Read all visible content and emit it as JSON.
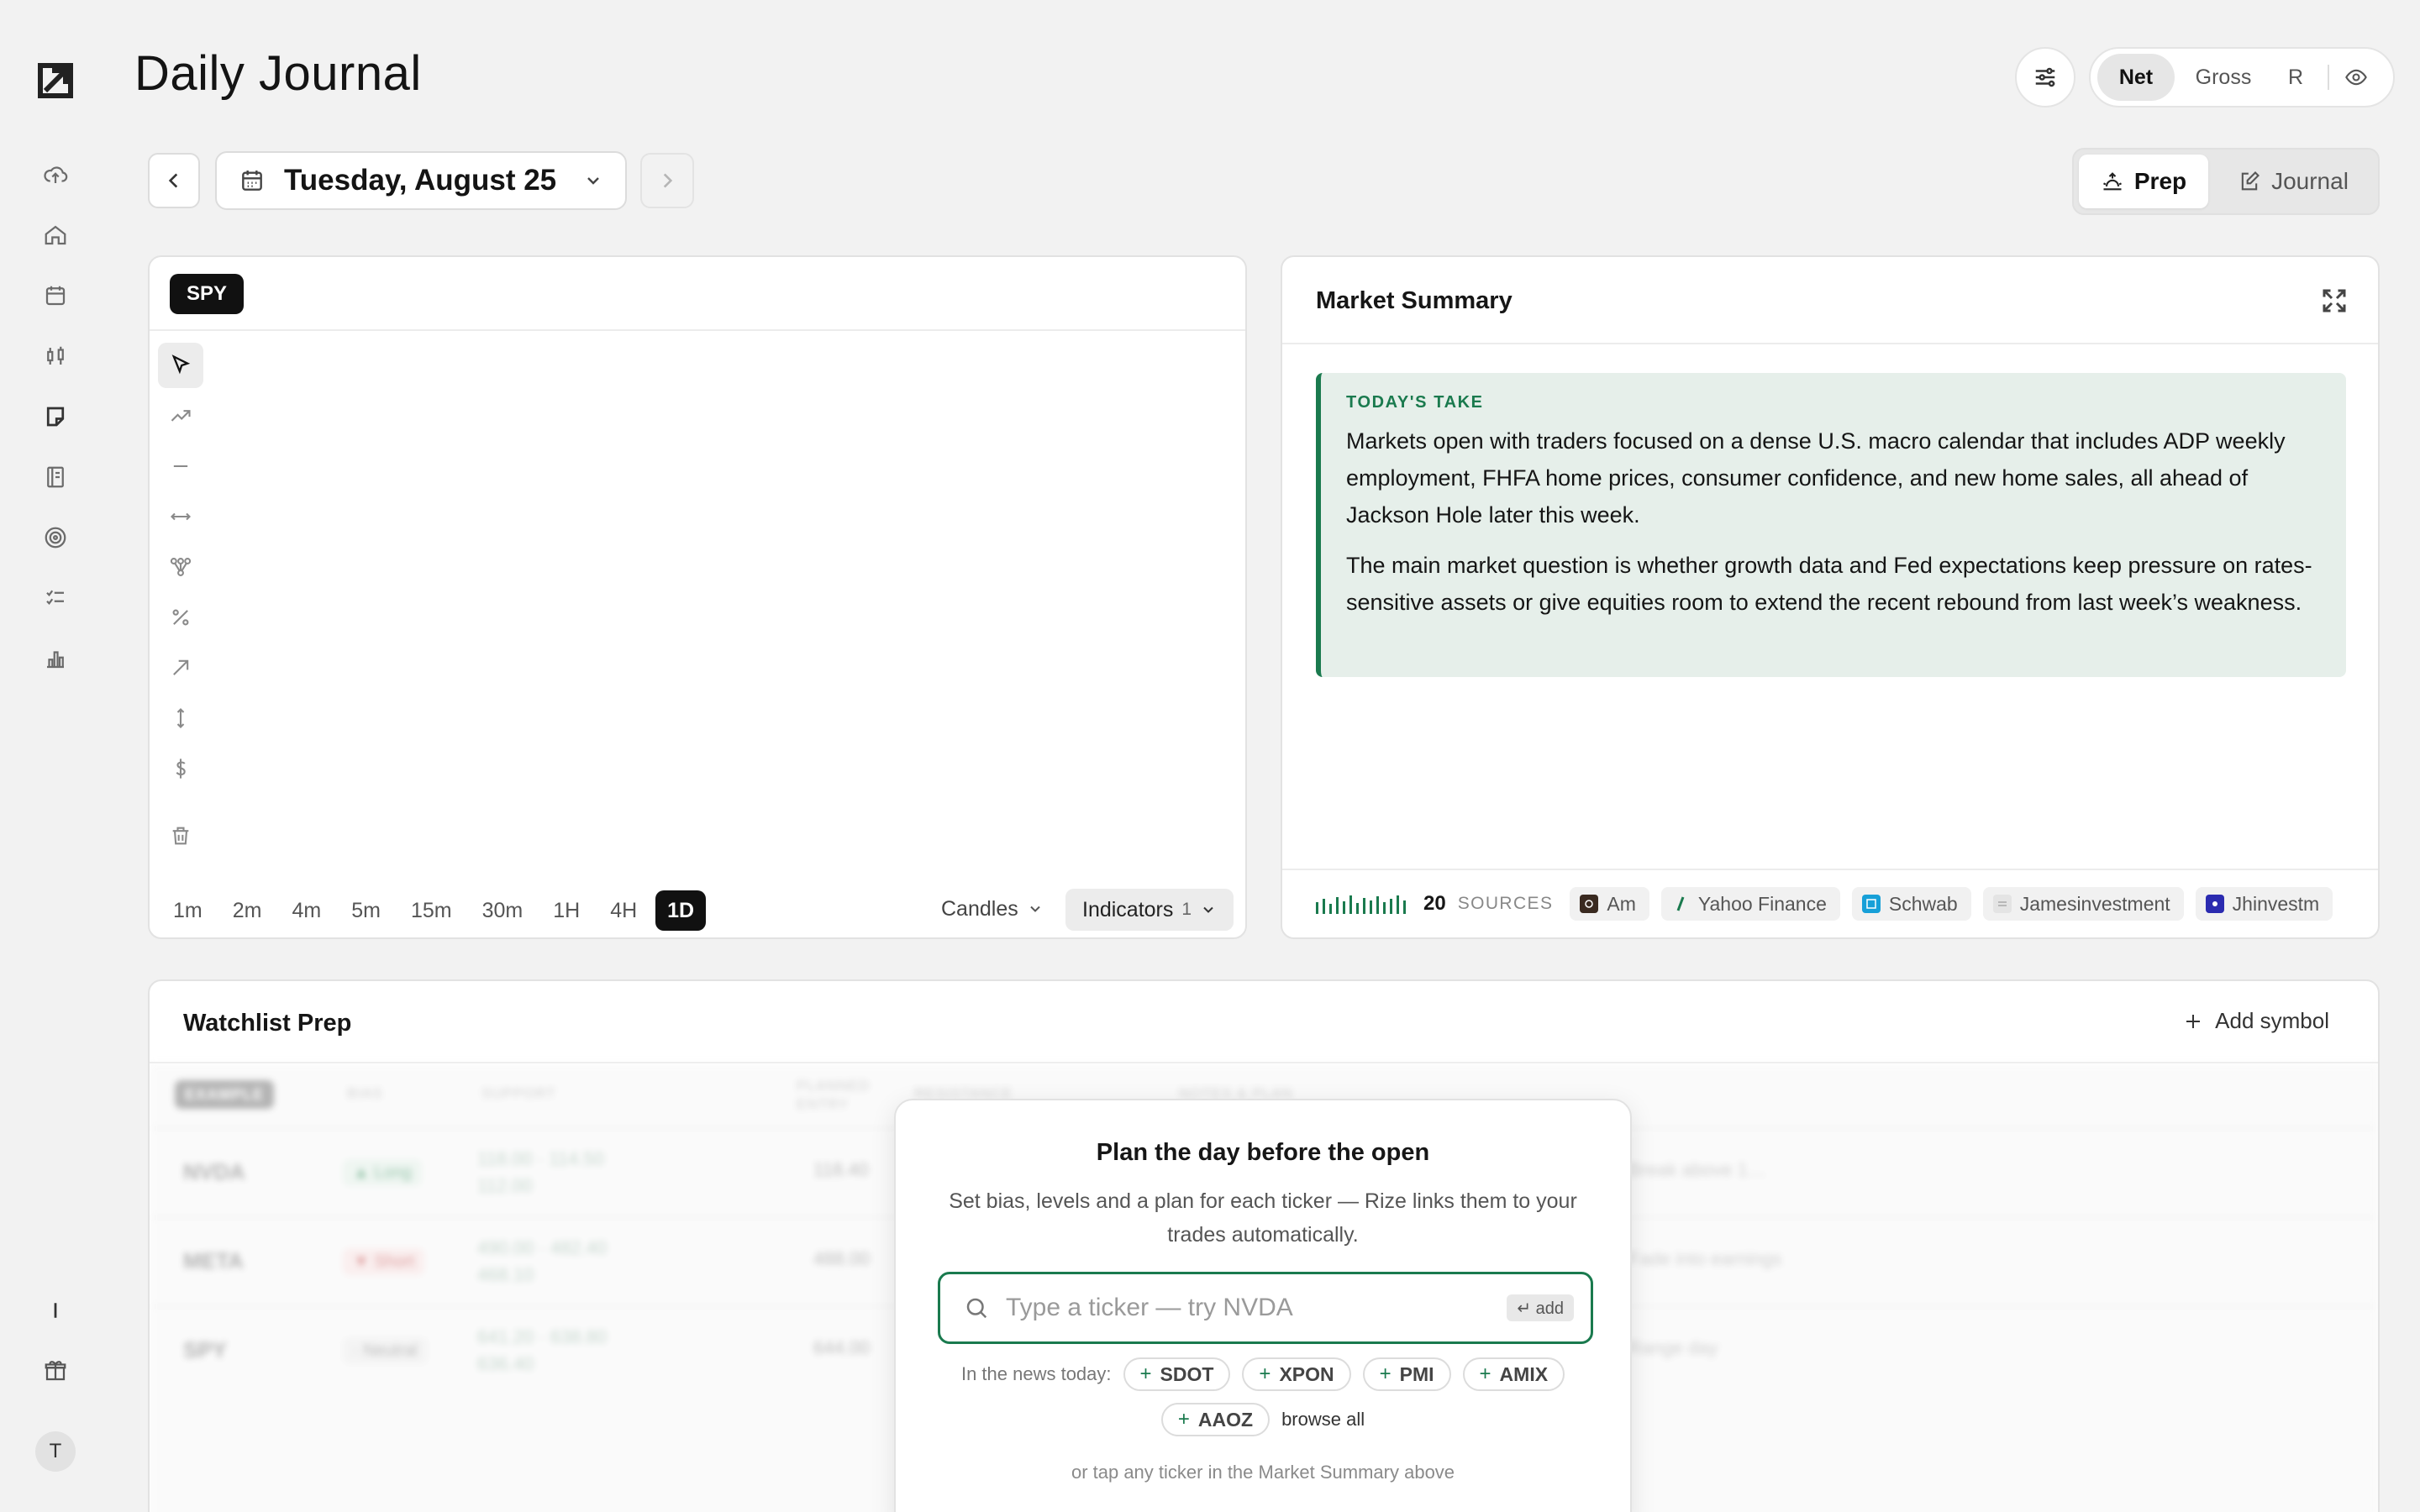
{
  "header": {
    "title": "Daily Journal",
    "mode_options": [
      "Net",
      "Gross",
      "R"
    ],
    "active_mode": "Net",
    "date": "Tuesday, August 25",
    "views": [
      "Prep",
      "Journal"
    ],
    "active_view": "Prep"
  },
  "sidebar": {
    "items": [
      "upload-icon",
      "home-icon",
      "calendar-icon",
      "candles-icon",
      "note-icon",
      "book-icon",
      "target-icon",
      "checklist-icon",
      "chart-icon"
    ],
    "bottom": [
      "divider-icon",
      "gift-icon"
    ],
    "avatar_initial": "T"
  },
  "chart": {
    "symbol": "SPY",
    "tools": [
      "cursor-icon",
      "trendline-icon",
      "horizontal-line-icon",
      "range-icon",
      "pitchfork-icon",
      "percent-icon",
      "arrow-icon",
      "vertical-range-icon",
      "dollar-icon",
      "trash-icon"
    ],
    "timeframes": [
      "1m",
      "2m",
      "4m",
      "5m",
      "15m",
      "30m",
      "1H",
      "4H",
      "1D"
    ],
    "active_timeframe": "1D",
    "style": "Candles",
    "indicators_label": "Indicators",
    "indicators_count": "1"
  },
  "summary": {
    "title": "Market Summary",
    "kicker": "TODAY'S TAKE",
    "paragraphs": [
      "Markets open with traders focused on a dense U.S. macro calendar that includes ADP weekly employment, FHFA home prices, consumer confidence, and new home sales, all ahead of Jackson Hole later this week.",
      "The main market question is whether growth data and Fed expectations keep pressure on rates-sensitive assets or give equities room to extend the recent rebound from last week’s weakness."
    ],
    "sources_count": "20",
    "sources_label": "SOURCES",
    "sources": [
      {
        "name": "Am",
        "color": "#3a2a20",
        "mark": "JPM"
      },
      {
        "name": "Yahoo Finance",
        "color": "#1a7a4e",
        "mark": "/"
      },
      {
        "name": "Schwab",
        "color": "#17a0d8",
        "mark": "cs"
      },
      {
        "name": "Jamesinvestment",
        "color": "#bbbbbb",
        "mark": "ji"
      },
      {
        "name": "Jhinvestm",
        "color": "#2b2bb0",
        "mark": "JH"
      }
    ]
  },
  "watchlist": {
    "title": "Watchlist Prep",
    "add_label": "Add symbol",
    "example_badge": "EXAMPLE",
    "columns": [
      "BIAS",
      "SUPPORT",
      "PLANNED ENTRY",
      "RESISTANCE",
      "NOTES & PLAN"
    ],
    "rows": [
      {
        "symbol": "NVDA",
        "bias": "▲ Long",
        "support": "118.00 · 114.50",
        "support2": "112.00",
        "entry": "118.40",
        "note": "Break above 1…"
      },
      {
        "symbol": "META",
        "bias": "▼ Short",
        "support": "490.00 · 482.40",
        "support2": "468.10",
        "entry": "488.00",
        "note": "Fade into earnings"
      },
      {
        "symbol": "SPY",
        "bias": "· Neutral",
        "support": "641.20 · 638.80",
        "support2": "636.40",
        "entry": "644.00",
        "note": "Range day"
      }
    ]
  },
  "onboarding": {
    "title": "Plan the day before the open",
    "description": "Set bias, levels and a plan for each ticker — Rize links them to your trades automatically.",
    "input_placeholder": "Type a ticker — try NVDA",
    "enter_hint": "↵ add",
    "news_label": "In the news today:",
    "tickers": [
      "SDOT",
      "XPON",
      "PMI",
      "AMIX",
      "AAOZ"
    ],
    "browse_label": "browse all",
    "footer": "or tap any ticker in the Market Summary above"
  }
}
